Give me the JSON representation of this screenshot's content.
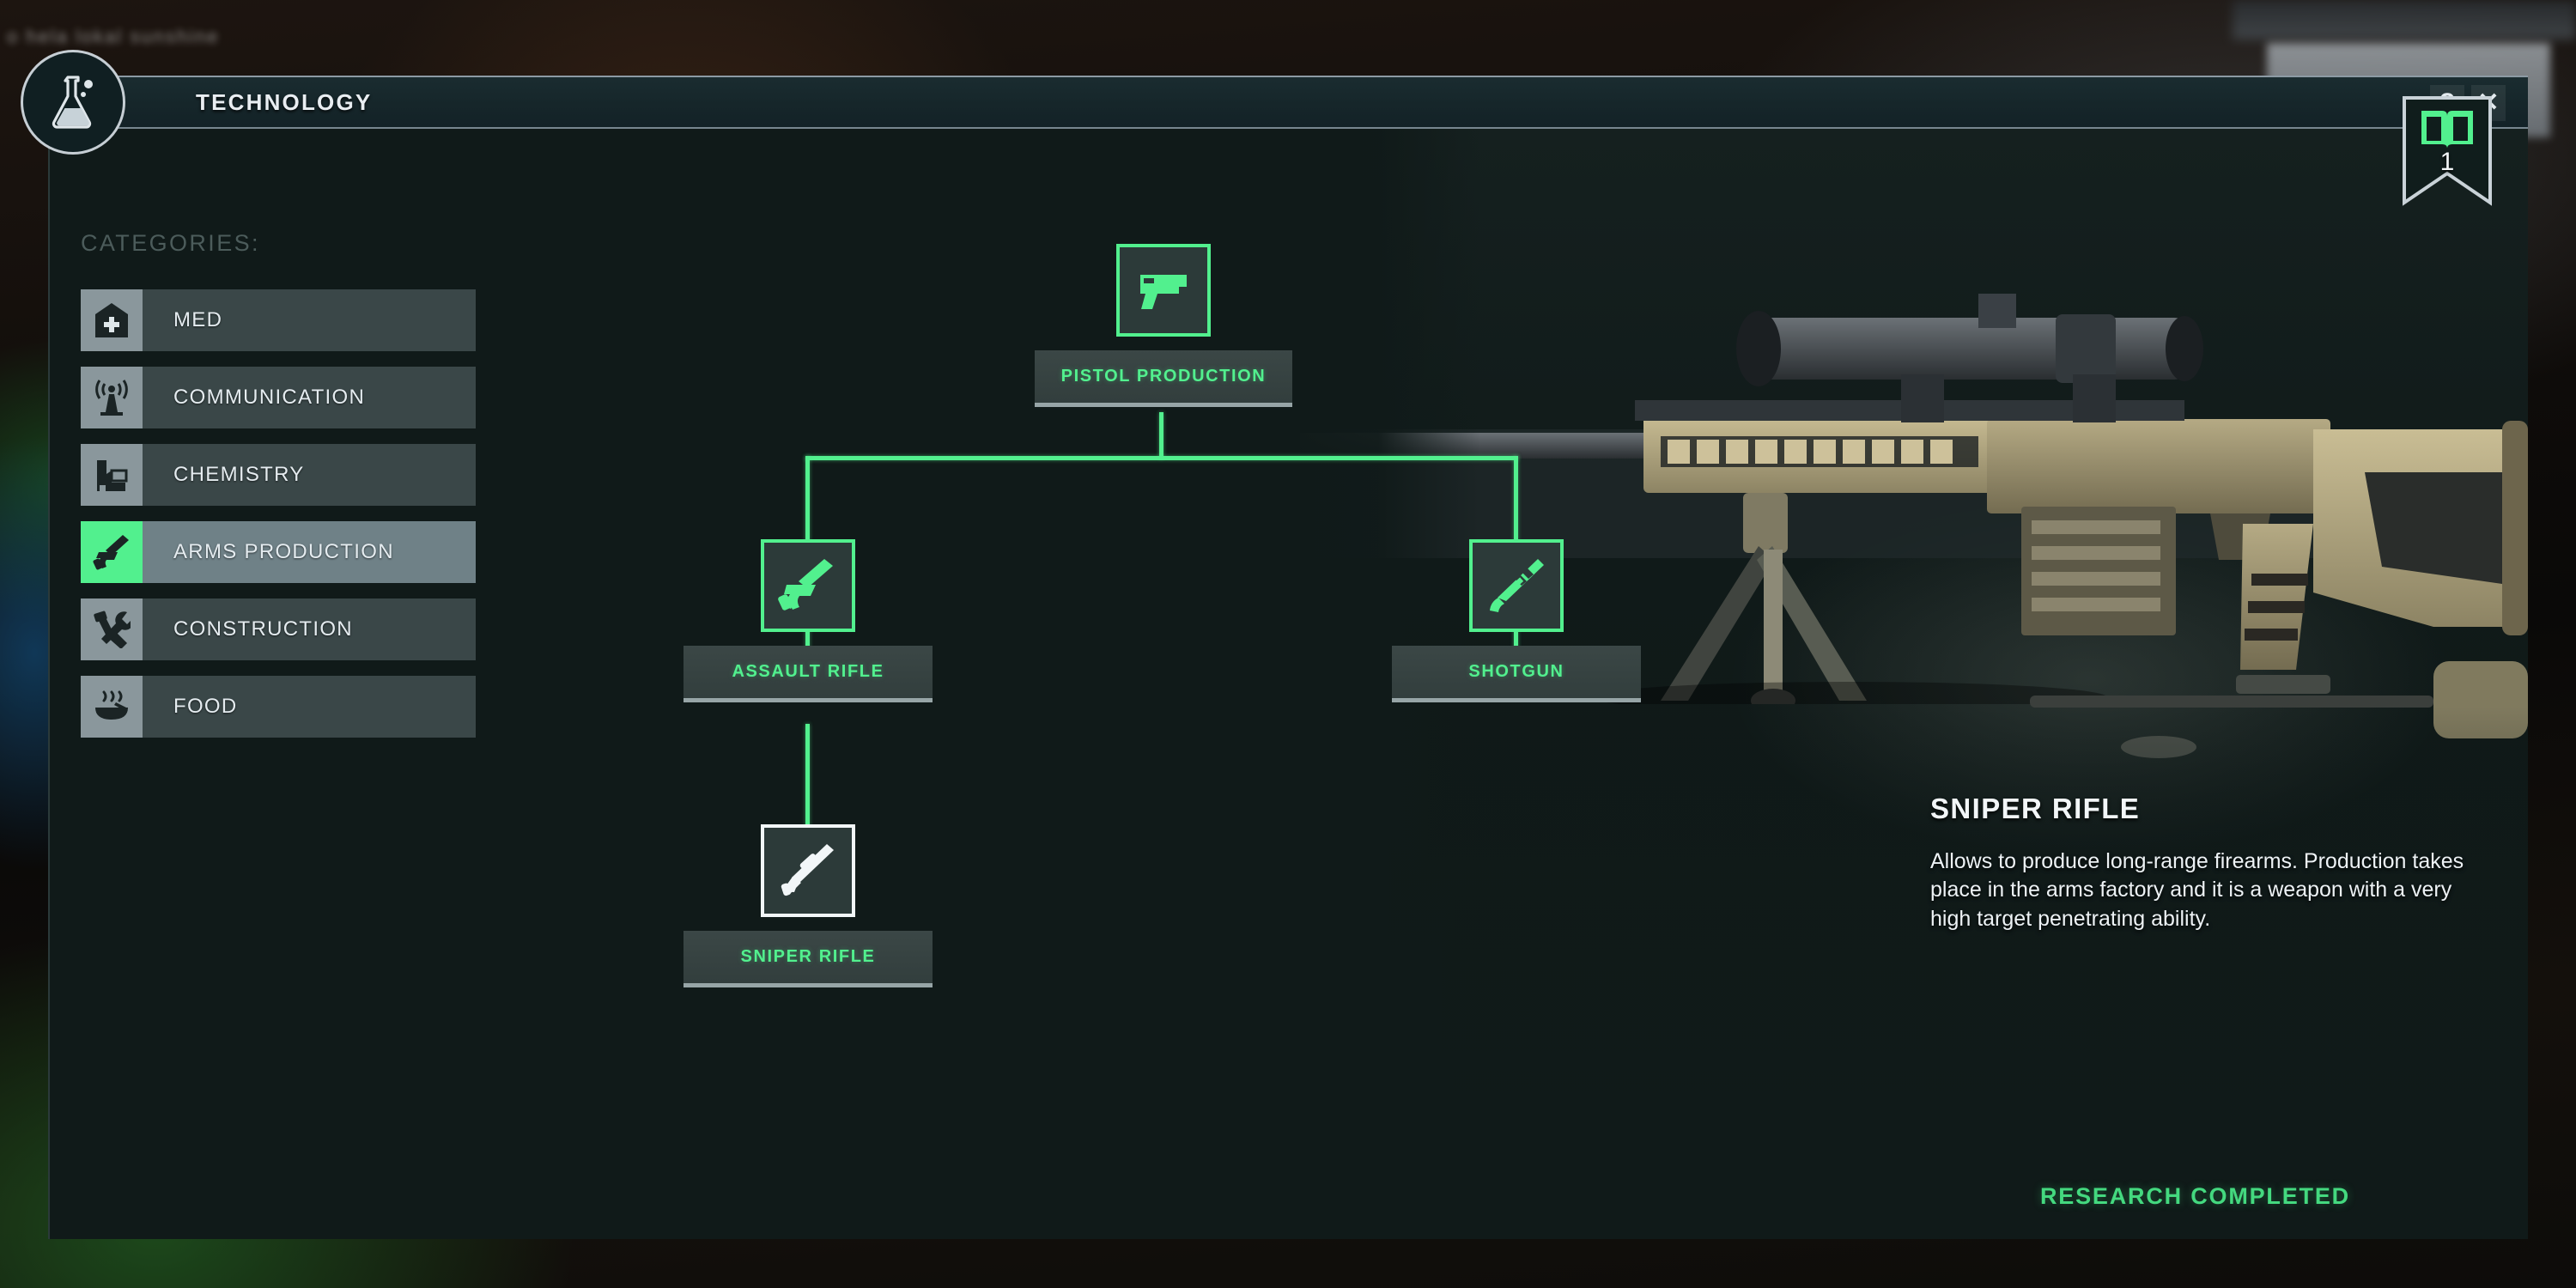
{
  "background": {
    "blurred_text": "o  hela  lokal  sunshine"
  },
  "header": {
    "title": "TECHNOLOGY",
    "icon": "flask-icon",
    "help_label": "?",
    "close_label": "✕"
  },
  "bookmark": {
    "icon": "open-book-icon",
    "count": "1"
  },
  "sidebar": {
    "title": "CATEGORIES:",
    "items": [
      {
        "label": "MED",
        "icon": "hospital-cross-icon",
        "active": false
      },
      {
        "label": "COMMUNICATION",
        "icon": "radio-tower-icon",
        "active": false
      },
      {
        "label": "CHEMISTRY",
        "icon": "chemistry-plant-icon",
        "active": false
      },
      {
        "label": "ARMS PRODUCTION",
        "icon": "assault-rifle-icon",
        "active": true
      },
      {
        "label": "CONSTRUCTION",
        "icon": "hammer-wrench-icon",
        "active": false
      },
      {
        "label": "FOOD",
        "icon": "soup-bowl-icon",
        "active": false
      }
    ]
  },
  "tech_tree": {
    "nodes": [
      {
        "id": "pistol",
        "label": "PISTOL PRODUCTION",
        "icon": "pistol-icon",
        "state": "researched"
      },
      {
        "id": "assault",
        "label": "ASSAULT RIFLE",
        "icon": "assault-rifle-icon",
        "state": "researched"
      },
      {
        "id": "shotgun",
        "label": "SHOTGUN",
        "icon": "shotgun-icon",
        "state": "researched"
      },
      {
        "id": "sniper",
        "label": "SNIPER RIFLE",
        "icon": "sniper-rifle-icon",
        "state": "selected"
      }
    ]
  },
  "info_panel": {
    "title": "SNIPER RIFLE",
    "description": "Allows to produce long-range firearms. Production takes place in the arms factory and it is a weapon with a very high target penetrating ability.",
    "status": "RESEARCH COMPLETED"
  },
  "colors": {
    "accent_green": "#52f08e",
    "status_green": "#44d97f",
    "panel_bg": "#101a19",
    "selected_border": "#f2f6f8"
  }
}
